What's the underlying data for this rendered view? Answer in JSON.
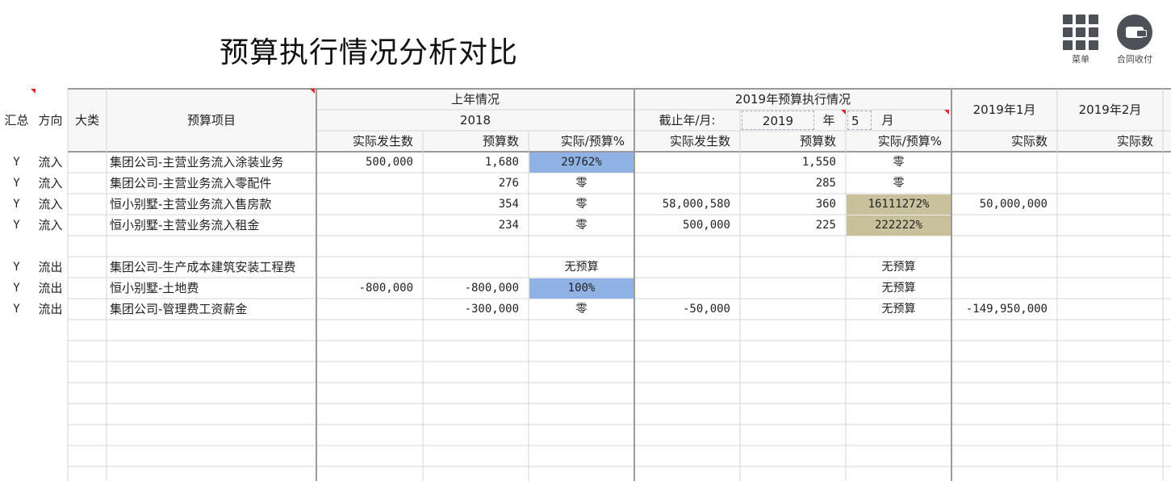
{
  "title": "预算执行情况分析对比",
  "toolbar": {
    "menu_label": "菜单",
    "menu_icon": "grid-menu-icon",
    "payment_label": "合同收付",
    "payment_icon": "wallet-icon"
  },
  "header": {
    "summary": "汇总",
    "direction": "方向",
    "category": "大类",
    "item": "预算项目",
    "last_year": "上年情况",
    "last_year_value": "2018",
    "exec_2019": "2019年预算执行情况",
    "cutoff_label": "截止年/月:",
    "cutoff_year": "2019",
    "year_unit": "年",
    "cutoff_month": "5",
    "month_unit": "月",
    "jan": "2019年1月",
    "feb": "2019年2月",
    "actual_occurred": "实际发生数",
    "budget": "预算数",
    "ratio": "实际/预算%",
    "actual": "实际数"
  },
  "rows": [
    {
      "summary": "Y",
      "direction": "流入",
      "item": "集团公司-主营业务流入涂装业务",
      "ly_actual": "500,000",
      "ly_budget": "1,680",
      "ly_ratio": "29762%",
      "cy_actual": "",
      "cy_budget": "1,550",
      "cy_ratio": "零",
      "jan": "",
      "feb": ""
    },
    {
      "summary": "Y",
      "direction": "流入",
      "item": "集团公司-主营业务流入零配件",
      "ly_actual": "",
      "ly_budget": "276",
      "ly_ratio": "零",
      "cy_actual": "",
      "cy_budget": "285",
      "cy_ratio": "零",
      "jan": "",
      "feb": ""
    },
    {
      "summary": "Y",
      "direction": "流入",
      "item": "恒小别墅-主营业务流入售房款",
      "ly_actual": "",
      "ly_budget": "354",
      "ly_ratio": "零",
      "cy_actual": "58,000,580",
      "cy_budget": "360",
      "cy_ratio": "16111272%",
      "jan": "50,000,000",
      "feb": ""
    },
    {
      "summary": "Y",
      "direction": "流入",
      "item": "恒小别墅-主营业务流入租金",
      "ly_actual": "",
      "ly_budget": "234",
      "ly_ratio": "零",
      "cy_actual": "500,000",
      "cy_budget": "225",
      "cy_ratio": "222222%",
      "jan": "",
      "feb": ""
    },
    {
      "summary": "",
      "direction": "",
      "item": "",
      "ly_actual": "",
      "ly_budget": "",
      "ly_ratio": "",
      "cy_actual": "",
      "cy_budget": "",
      "cy_ratio": "",
      "jan": "",
      "feb": ""
    },
    {
      "summary": "Y",
      "direction": "流出",
      "item": "集团公司-生产成本建筑安装工程费",
      "ly_actual": "",
      "ly_budget": "",
      "ly_ratio": "无预算",
      "cy_actual": "",
      "cy_budget": "",
      "cy_ratio": "无预算",
      "jan": "",
      "feb": ""
    },
    {
      "summary": "Y",
      "direction": "流出",
      "item": "恒小别墅-土地费",
      "ly_actual": "-800,000",
      "ly_budget": "-800,000",
      "ly_ratio": "100%",
      "cy_actual": "",
      "cy_budget": "",
      "cy_ratio": "无预算",
      "jan": "",
      "feb": ""
    },
    {
      "summary": "Y",
      "direction": "流出",
      "item": "集团公司-管理费工资薪金",
      "ly_actual": "",
      "ly_budget": "-300,000",
      "ly_ratio": "零",
      "cy_actual": "-50,000",
      "cy_budget": "",
      "cy_ratio": "无预算",
      "jan": "-149,950,000",
      "feb": ""
    }
  ],
  "highlights": {
    "blue": "#8fb1e3",
    "khaki": "#c9c19b",
    "grid_line": "#d4d4d4",
    "header_line": "#9a9a9a",
    "comment_flag": "#d9262b"
  }
}
